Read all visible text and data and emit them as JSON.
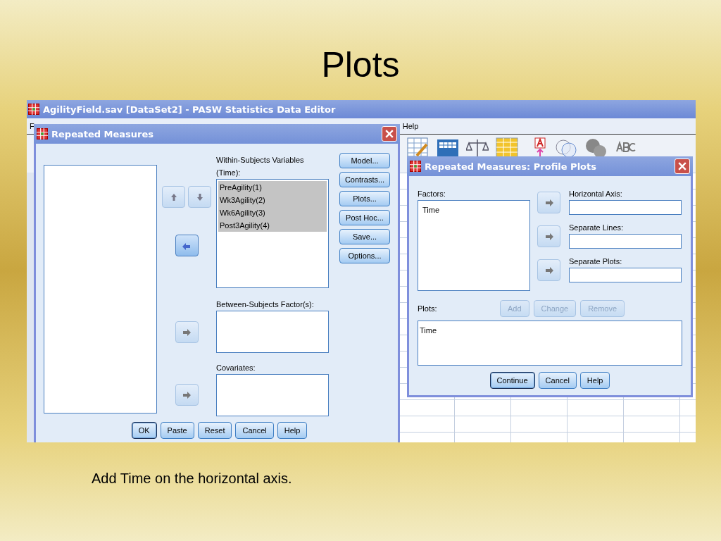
{
  "slide": {
    "title": "Plots",
    "caption": "Add Time on the horizontal axis."
  },
  "main_window": {
    "title": "AgilityField.sav [DataSet2] - PASW Statistics Data Editor",
    "menu": [
      "F",
      "Help"
    ]
  },
  "repeated_measures": {
    "title": "Repeated Measures",
    "within_label": "Within-Subjects Variables (Time):",
    "within_items": [
      {
        "label": "PreAgility(1)",
        "selected": true
      },
      {
        "label": "Wk3Agility(2)",
        "selected": true
      },
      {
        "label": "Wk6Agility(3)",
        "selected": true
      },
      {
        "label": "Post3Agility(4)",
        "selected": true
      }
    ],
    "between_label": "Between-Subjects Factor(s):",
    "covariates_label": "Covariates:",
    "side_buttons": [
      "Model...",
      "Contrasts...",
      "Plots...",
      "Post Hoc...",
      "Save...",
      "Options..."
    ],
    "bottom_buttons": [
      {
        "label": "OK",
        "default": true
      },
      {
        "label": "Paste",
        "default": false
      },
      {
        "label": "Reset",
        "default": false
      },
      {
        "label": "Cancel",
        "default": false
      },
      {
        "label": "Help",
        "default": false
      }
    ]
  },
  "profile_plots": {
    "title": "Repeated Measures: Profile Plots",
    "factors_label": "Factors:",
    "factors": [
      "Time"
    ],
    "targets": [
      "Horizontal Axis:",
      "Separate Lines:",
      "Separate Plots:"
    ],
    "plots_label": "Plots:",
    "plot_actions": [
      {
        "label": "Add",
        "disabled": true
      },
      {
        "label": "Change",
        "disabled": true
      },
      {
        "label": "Remove",
        "disabled": true
      }
    ],
    "plots": [
      "Time"
    ],
    "buttons": [
      {
        "label": "Continue",
        "default": true
      },
      {
        "label": "Cancel",
        "default": false
      },
      {
        "label": "Help",
        "default": false
      }
    ]
  }
}
